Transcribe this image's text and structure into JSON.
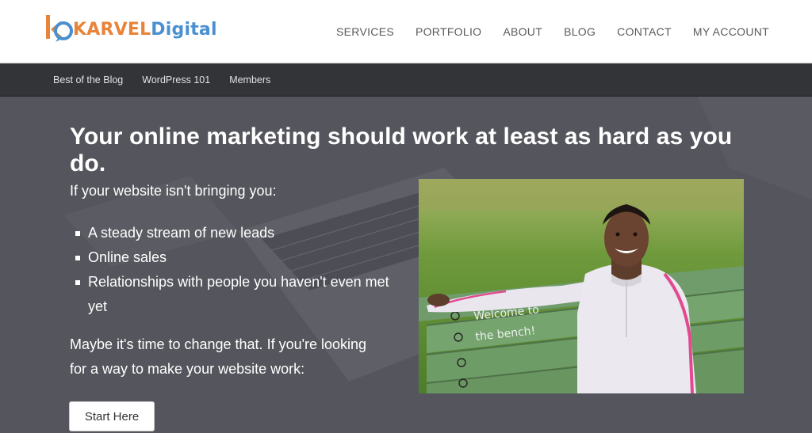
{
  "brand": {
    "name_part1": "KARVEL",
    "name_part2": "Digital",
    "colors": {
      "orange": "#e8843a",
      "blue": "#4a8fcf"
    }
  },
  "main_nav": [
    {
      "label": "SERVICES"
    },
    {
      "label": "PORTFOLIO"
    },
    {
      "label": "ABOUT"
    },
    {
      "label": "BLOG"
    },
    {
      "label": "CONTACT"
    },
    {
      "label": "MY ACCOUNT"
    }
  ],
  "sub_nav": [
    {
      "label": "Best of the Blog"
    },
    {
      "label": "WordPress 101"
    },
    {
      "label": "Members"
    }
  ],
  "hero": {
    "title": "Your online marketing should work at least as hard as you do.",
    "intro": "If your website isn't bringing you:",
    "bullets": [
      "A steady stream of new leads",
      "Online sales",
      "Relationships with people you haven't even met yet"
    ],
    "closing": "Maybe it's time to change that. If you're looking for a way to make your website work:",
    "cta_label": "Start Here",
    "photo": {
      "bench_text_line1": "Welcome to",
      "bench_text_line2": "the bench!"
    }
  }
}
